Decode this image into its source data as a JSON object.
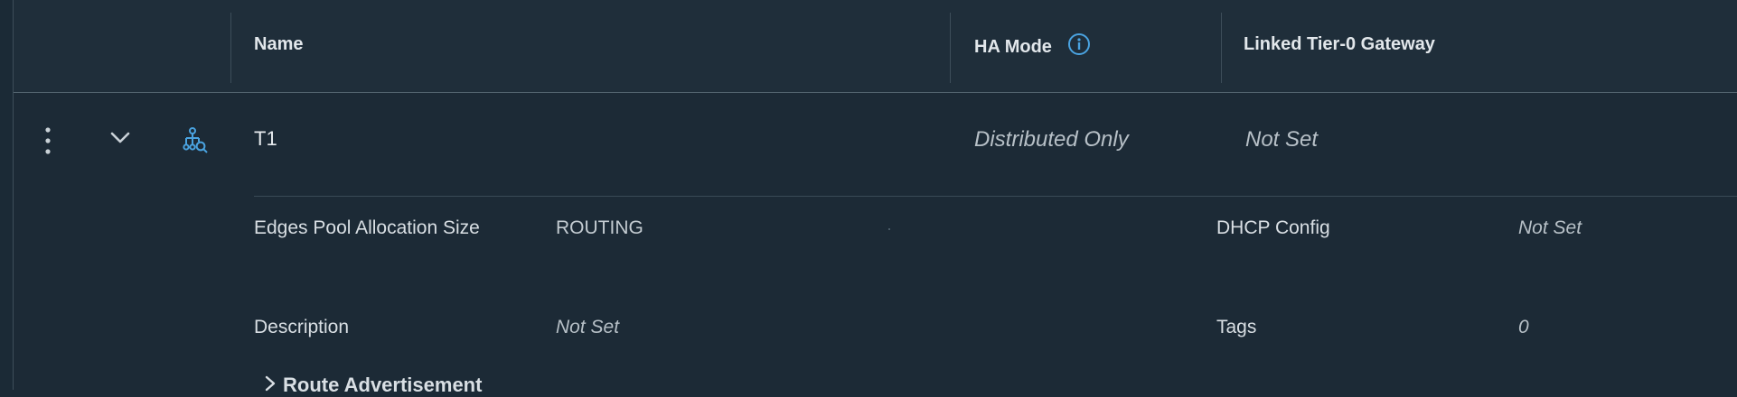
{
  "table": {
    "columns": {
      "name": "Name",
      "ha_mode": "HA Mode",
      "linked_tier0": "Linked Tier-0 Gateway"
    },
    "row": {
      "name": "T1",
      "ha_mode": "Distributed Only",
      "linked_tier0": "Not Set",
      "expanded": true
    },
    "details": {
      "edges_pool_label": "Edges Pool Allocation Size",
      "edges_pool_value": "ROUTING",
      "dhcp_label": "DHCP Config",
      "dhcp_value": "Not Set",
      "description_label": "Description",
      "description_value": "Not Set",
      "tags_label": "Tags",
      "tags_value": "0",
      "route_advertisement_label": "Route Advertisement"
    }
  },
  "icons": {
    "row_menu": "kebab-menu-icon",
    "expand": "chevron-down-icon",
    "gateway": "tier1-gateway-icon",
    "info": "info-icon"
  },
  "colors": {
    "background": "#1c2a36",
    "header": "#1f2e3a",
    "accent": "#4aa3e0"
  }
}
